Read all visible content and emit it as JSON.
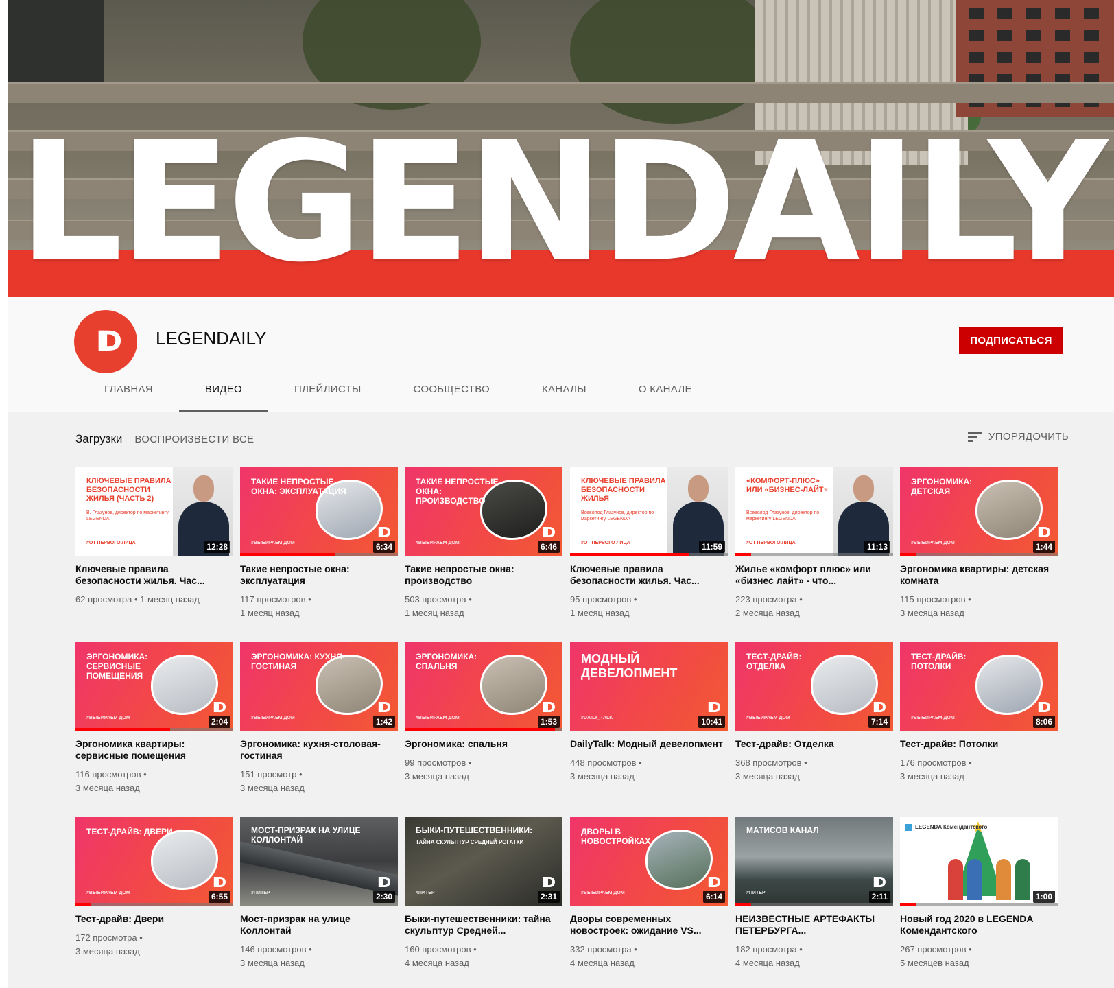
{
  "banner": {
    "title": "LEGENDAILY"
  },
  "channel": {
    "name": "LEGENDAILY",
    "subscribe_label": "ПОДПИСАТЬСЯ"
  },
  "tabs": [
    {
      "label": "ГЛАВНАЯ"
    },
    {
      "label": "ВИДЕО"
    },
    {
      "label": "ПЛЕЙЛИСТЫ"
    },
    {
      "label": "СООБЩЕСТВО"
    },
    {
      "label": "КАНАЛЫ"
    },
    {
      "label": "О КАНАЛЕ"
    }
  ],
  "section": {
    "title": "Загрузки",
    "play_all": "ВОСПРОИЗВЕСТИ ВСЕ",
    "sort_label": "УПОРЯДОЧИТЬ"
  },
  "videos": [
    {
      "thumb_title": "КЛЮЧЕВЫЕ ПРАВИЛА БЕЗОПАСНОСТИ ЖИЛЬЯ (ЧАСТЬ 2)",
      "thumb_sub": "В. Глазунов, директор по маркетингу LEGENDA",
      "thumb_tag": "#ОТ ПЕРВОГО ЛИЦА",
      "duration": "12:28",
      "title": "Ключевые правила безопасности жилья. Час...",
      "meta1": "62 просмотра • 1 месяц назад",
      "meta2": "",
      "progress": 0
    },
    {
      "thumb_title": "ТАКИЕ НЕПРОСТЫЕ ОКНА: ЭКСПЛУАТАЦИЯ",
      "thumb_tag": "#ВЫБИРАЕМ ДОМ",
      "duration": "6:34",
      "title": "Такие непростые окна: эксплуатация",
      "meta1": "117 просмотров •",
      "meta2": "1 месяц назад",
      "progress": 0.6
    },
    {
      "thumb_title": "ТАКИЕ НЕПРОСТЫЕ ОКНА: ПРОИЗВОДСТВО",
      "thumb_tag": "#ВЫБИРАЕМ ДОМ",
      "duration": "6:46",
      "title": "Такие непростые окна: производство",
      "meta1": "503 просмотра •",
      "meta2": "1 месяц назад",
      "progress": 0
    },
    {
      "thumb_title": "КЛЮЧЕВЫЕ ПРАВИЛА БЕЗОПАСНОСТИ ЖИЛЬЯ",
      "thumb_sub": "Всеволод Глазунов, директор по маркетингу LEGENDA",
      "thumb_tag": "#ОТ ПЕРВОГО ЛИЦА",
      "duration": "11:59",
      "title": "Ключевые правила безопасности жилья. Час...",
      "meta1": "95 просмотров •",
      "meta2": "1 месяц назад",
      "progress": 0.75
    },
    {
      "thumb_title": "«КОМФОРТ-ПЛЮС» ИЛИ «БИЗНЕС-ЛАЙТ»",
      "thumb_sub": "Всеволод Глазунов, директор по маркетингу LEGENDA",
      "thumb_tag": "#ОТ ПЕРВОГО ЛИЦА",
      "duration": "11:13",
      "title": "Жилье «комфорт плюс» или «бизнес лайт» - что...",
      "meta1": "223 просмотра •",
      "meta2": "2 месяца назад",
      "progress": 0.1
    },
    {
      "thumb_title": "ЭРГОНОМИКА: ДЕТСКАЯ",
      "thumb_tag": "#ВЫБИРАЕМ ДОМ",
      "duration": "1:44",
      "title": "Эргономика квартиры: детская комната",
      "meta1": "115 просмотров •",
      "meta2": "3 месяца назад",
      "progress": 0.1
    },
    {
      "thumb_title": "ЭРГОНОМИКА: СЕРВИСНЫЕ ПОМЕЩЕНИЯ",
      "thumb_tag": "#ВЫБИРАЕМ ДОМ",
      "duration": "2:04",
      "title": "Эргономика квартиры: сервисные помещения",
      "meta1": "116 просмотров •",
      "meta2": "3 месяца назад",
      "progress": 0.6
    },
    {
      "thumb_title": "ЭРГОНОМИКА: КУХНЯ-ГОСТИНАЯ",
      "thumb_tag": "#ВЫБИРАЕМ ДОМ",
      "duration": "1:42",
      "title": "Эргономика: кухня-столовая-гостиная",
      "meta1": "151 просмотр •",
      "meta2": "3 месяца назад",
      "progress": 0
    },
    {
      "thumb_title": "ЭРГОНОМИКА: СПАЛЬНЯ",
      "thumb_tag": "#ВЫБИРАЕМ ДОМ",
      "duration": "1:53",
      "title": "Эргономика: спальня",
      "meta1": "99 просмотров •",
      "meta2": "3 месяца назад",
      "progress": 0.95
    },
    {
      "thumb_title": "МОДНЫЙ ДЕВЕЛОПМЕНТ",
      "thumb_tag": "#DAILY_TALK",
      "duration": "10:41",
      "title": "DailyTalk: Модный девелопмент",
      "meta1": "448 просмотров •",
      "meta2": "3 месяца назад",
      "progress": 0
    },
    {
      "thumb_title": "ТЕСТ-ДРАЙВ: ОТДЕЛКА",
      "thumb_tag": "#ВЫБИРАЕМ ДОМ",
      "duration": "7:14",
      "title": "Тест-драйв: Отделка",
      "meta1": "368 просмотров •",
      "meta2": "3 месяца назад",
      "progress": 0
    },
    {
      "thumb_title": "ТЕСТ-ДРАЙВ: ПОТОЛКИ",
      "thumb_tag": "#ВЫБИРАЕМ ДОМ",
      "duration": "8:06",
      "title": "Тест-драйв: Потолки",
      "meta1": "176 просмотров •",
      "meta2": "3 месяца назад",
      "progress": 0
    },
    {
      "thumb_title": "ТЕСТ-ДРАЙВ: ДВЕРИ",
      "thumb_tag": "#ВЫБИРАЕМ ДОМ",
      "duration": "6:55",
      "title": "Тест-драйв: Двери",
      "meta1": "172 просмотра •",
      "meta2": "3 месяца назад",
      "progress": 0.1
    },
    {
      "thumb_title": "МОСТ-ПРИЗРАК НА УЛИЦЕ КОЛЛОНТАЙ",
      "thumb_tag": "#ПИТЕР",
      "duration": "2:30",
      "title": "Мост-призрак на улице Коллонтай",
      "meta1": "146 просмотров •",
      "meta2": "3 месяца назад",
      "progress": 0
    },
    {
      "thumb_title": "БЫКИ-ПУТЕШЕСТВЕННИКИ:",
      "thumb_sub": "ТАЙНА СКУЛЬПТУР СРЕДНЕЙ РОГАТКИ",
      "thumb_tag": "#ПИТЕР",
      "duration": "2:31",
      "title": "Быки-путешественники: тайна скульптур Средней...",
      "meta1": "160 просмотров •",
      "meta2": "4 месяца назад",
      "progress": 0
    },
    {
      "thumb_title": "ДВОРЫ В НОВОСТРОЙКАХ",
      "thumb_tag": "#ВЫБИРАЕМ ДОМ",
      "duration": "6:14",
      "title": "Дворы современных новостроек: ожидание VS...",
      "meta1": "332 просмотра •",
      "meta2": "4 месяца назад",
      "progress": 0
    },
    {
      "thumb_title": "МАТИСОВ КАНАЛ",
      "thumb_tag": "#ПИТЕР",
      "duration": "2:11",
      "title": "НЕИЗВЕСТНЫЕ АРТЕФАКТЫ ПЕТЕРБУРГА...",
      "meta1": "182 просмотра •",
      "meta2": "4 месяца назад",
      "progress": 0.1
    },
    {
      "thumb_title": "LEGENDA Комендантского",
      "duration": "1:00",
      "title": "Новый год 2020 в LEGENDA Комендантского",
      "meta1": "267 просмотров •",
      "meta2": "5 месяцев назад",
      "progress": 0.1
    }
  ]
}
